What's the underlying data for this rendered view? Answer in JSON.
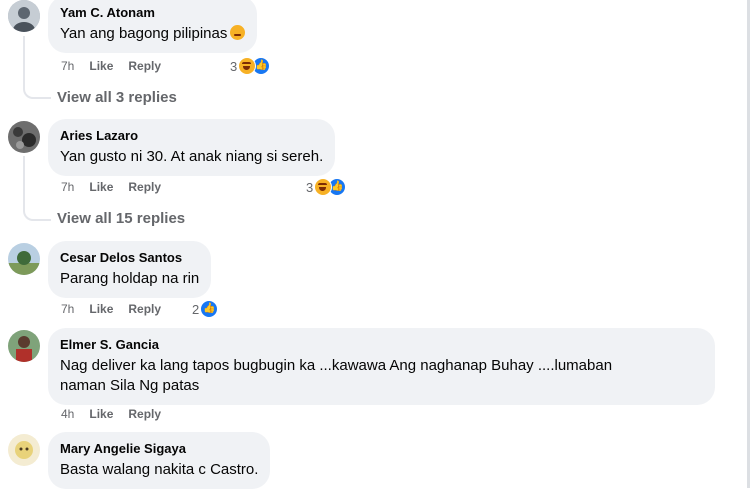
{
  "comments": [
    {
      "name": "Yam C. Atonam",
      "text": "Yan ang bagong pilipinas",
      "time": "7h",
      "like": "Like",
      "reply": "Reply",
      "reactions": "3",
      "reaction_icons": [
        "haha-icon",
        "like-icon"
      ],
      "view_replies": "View all 3 replies"
    },
    {
      "name": "Aries Lazaro",
      "text": "Yan gusto ni 30. At anak niang si sereh.",
      "time": "7h",
      "like": "Like",
      "reply": "Reply",
      "reactions": "3",
      "reaction_icons": [
        "haha-icon",
        "like-icon"
      ],
      "view_replies": "View all 15 replies"
    },
    {
      "name": "Cesar Delos Santos",
      "text": "Parang holdap na rin",
      "time": "7h",
      "like": "Like",
      "reply": "Reply",
      "reactions": "2",
      "reaction_icons": [
        "like-icon"
      ]
    },
    {
      "name": "Elmer S. Gancia",
      "text_line1": "Nag deliver ka lang tapos bugbugin ka ...kawawa Ang naghanap Buhay ....lumaban",
      "text_line2": "naman Sila Ng patas",
      "time": "4h",
      "like": "Like",
      "reply": "Reply"
    },
    {
      "name": "Mary Angelie Sigaya",
      "text": "Basta walang nakita c Castro."
    }
  ],
  "colors": {
    "bubble": "#f0f2f5",
    "meta": "#65676b",
    "like_blue": "#1877f2",
    "haha_yellow": "#f7b125"
  }
}
